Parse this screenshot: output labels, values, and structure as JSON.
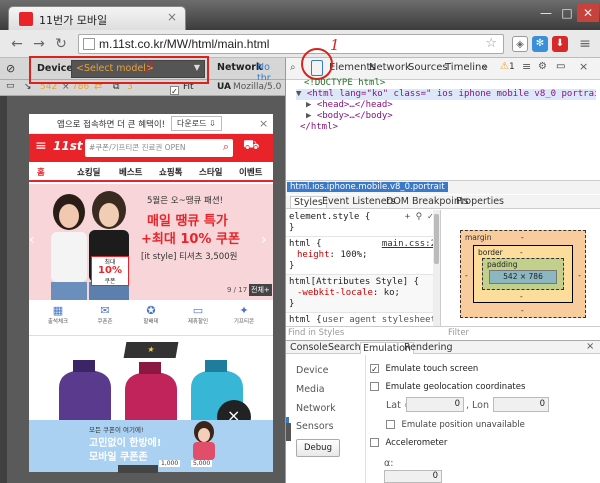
{
  "browser": {
    "tab_title": "11번가 모바일",
    "url": "m.11st.co.kr/MW/html/main.html"
  },
  "emulation_bar": {
    "device_label": "Device",
    "device_select": "<Select model>",
    "network_label": "Network",
    "network_value": "No thr",
    "width": "542",
    "height": "786",
    "dpr": "3",
    "fit_label": "Fit",
    "ua_label": "UA",
    "ua_value": "Mozilla/5.0 (i"
  },
  "annotations": {
    "circle_label": "1",
    "box_label": "2"
  },
  "phone": {
    "banner_text": "앱으로 접속하면 더 큰 혜택이!",
    "banner_button": "다운로드",
    "logo": "11st",
    "search_placeholder": "#쿠폰/기프티콘 진료권 OPEN",
    "menu": [
      "홈",
      "쇼킹딜",
      "베스트",
      "쇼핑톡",
      "스타일",
      "이벤트"
    ],
    "promo_line1": "5월은 오~땡큐 패션!",
    "promo_line2": "매일 땡큐 특가",
    "promo_line3": "+최대 10% 쿠폰",
    "promo_line4": "[it style] 티셔츠 3,500원",
    "coupon_top": "최대",
    "coupon_big": "10%",
    "coupon_bottom": "쿠폰",
    "pager": "9 / 17",
    "all_view": "전체+",
    "quick_icons": [
      "출석체크",
      "쿠폰존",
      "할배데",
      "제휴할인",
      "기프티콘"
    ],
    "bottom_small": "모든 쿠폰이 여기에!",
    "bottom_big1": "고민없이 한방에!",
    "bottom_big2": "모바일 쿠폰존",
    "coupon_chip1": "1,000",
    "coupon_chip2": "5,000"
  },
  "devtools": {
    "tabs": [
      "Elements",
      "Network",
      "Sources",
      "Timeline"
    ],
    "warn_count": "1",
    "err_count": "2",
    "dom": {
      "doctype": "<!DOCTYPE html>",
      "html_open": "<html lang=\"ko\" class=\" ios iphone mobile v8_0 portrait\">",
      "head": "<head>…</head>",
      "body": "<body>…</body>",
      "html_close": "</html>"
    },
    "breadcrumb": "html.ios.iphone.mobile.v8_0.portrait",
    "side_tabs": [
      "Styles",
      "Event Listeners",
      "DOM Breakpoints",
      "Properties"
    ],
    "styles": {
      "element_style": "element.style {",
      "close1": "}",
      "rule1_sel": "html {",
      "rule1_src": "main.css:2",
      "rule1_prop": "height",
      "rule1_val": "100%;",
      "close2": "}",
      "rule2_sel": "html[Attributes Style] {",
      "rule2_prop": "-webkit-locale",
      "rule2_val": "ko;",
      "close3": "}",
      "rule3_sel": "html {",
      "rule3_src": "user agent stylesheet"
    },
    "find_placeholder": "Find in Styles",
    "filter_placeholder": "Filter",
    "boxmodel": {
      "margin": "margin",
      "border": "border",
      "padding": "padding",
      "dash": "-",
      "content": "542 × 786"
    },
    "drawer_tabs": [
      "Console",
      "Search",
      "Emulation",
      "Rendering"
    ],
    "emu_nav": [
      "Device",
      "Media",
      "Network",
      "Sensors"
    ],
    "emu": {
      "touch": "Emulate touch screen",
      "geo": "Emulate geolocation coordinates",
      "lat_label": "Lat =",
      "lat_value": "0",
      "lon_label": ", Lon =",
      "lon_value": "0",
      "pos_unavail": "Emulate position unavailable",
      "accelerometer": "Accelerometer",
      "alpha_label": "α:",
      "alpha_value": "0",
      "debug_button": "Debug"
    }
  }
}
